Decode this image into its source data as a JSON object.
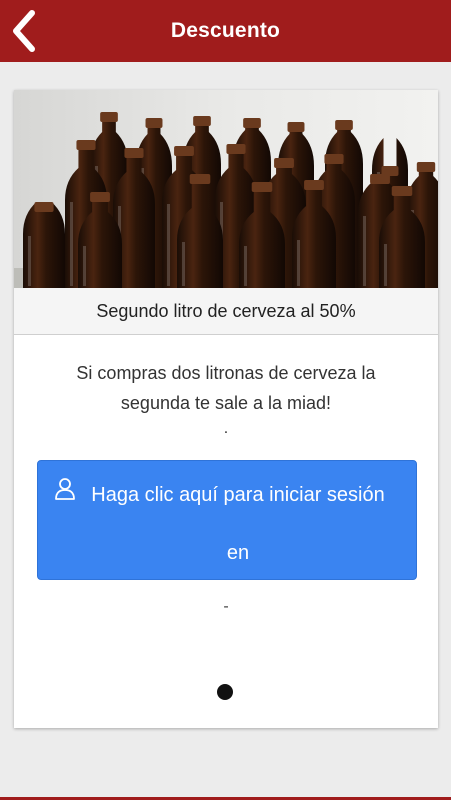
{
  "header": {
    "title": "Descuento",
    "back_icon": "chevron-left-icon",
    "background_color": "#a01c1c"
  },
  "offer": {
    "image": "beer-bottles-photo",
    "title": "Segundo litro de cerveza al 50%",
    "description": "Si compras dos litronas de cerveza la segunda te sale a la miad!",
    "separator_text": ".",
    "footer_text": "-"
  },
  "login_button": {
    "icon": "user-icon",
    "label": "Haga clic aquí para iniciar sesión en",
    "background_color": "#3a84f1"
  },
  "pager": {
    "icon": "page-indicator-dot"
  }
}
